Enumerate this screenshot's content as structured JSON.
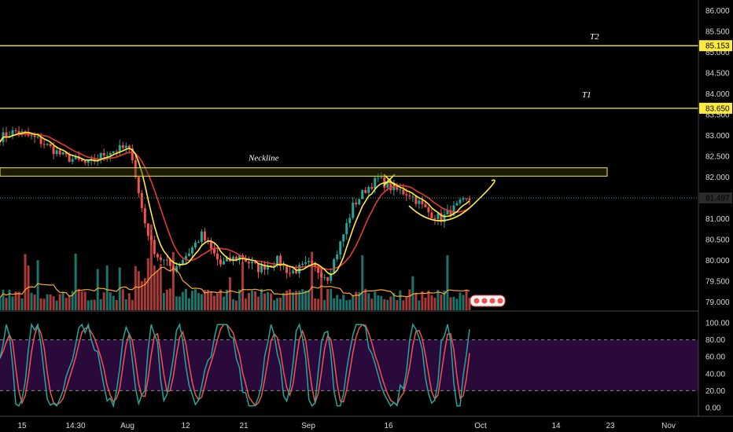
{
  "chart_data": {
    "type": "candlestick",
    "price_axis": {
      "ticks": [
        "79.000",
        "79.500",
        "80.000",
        "80.500",
        "81.000",
        "81.500",
        "82.000",
        "82.500",
        "83.000",
        "83.500",
        "84.000",
        "84.500",
        "85.000",
        "85.500",
        "86.000"
      ],
      "tick_values": [
        79.0,
        79.5,
        80.0,
        80.5,
        81.0,
        81.5,
        82.0,
        82.5,
        83.0,
        83.5,
        84.0,
        84.5,
        85.0,
        85.5,
        86.0
      ],
      "ylim": [
        78.8,
        86.25
      ]
    },
    "oscillator_axis": {
      "ticks": [
        "0.00",
        "20.00",
        "40.00",
        "60.00",
        "80.00",
        "100.00"
      ],
      "tick_values": [
        0,
        20,
        40,
        60,
        80,
        100
      ],
      "overbought": 80,
      "oversold": 20
    },
    "x_ticks": [
      "15",
      "14:30",
      "Aug",
      "12",
      "21",
      "Sep",
      "16",
      "Oct",
      "14",
      "23",
      "Nov"
    ],
    "levels": [
      {
        "name": "T2",
        "value": 85.153,
        "label": "85.153",
        "color": "#ffeb3b"
      },
      {
        "name": "T1",
        "value": 83.65,
        "label": "83.650",
        "color": "#ffeb3b"
      }
    ],
    "last_price": {
      "value": 81.497,
      "label": "81.497"
    },
    "zone": {
      "name": "Neckline",
      "low": 82.02,
      "high": 82.22
    },
    "price_series": {
      "n": 150,
      "close_anchors": [
        [
          0,
          82.95
        ],
        [
          5,
          83.1
        ],
        [
          12,
          82.9
        ],
        [
          20,
          82.5
        ],
        [
          28,
          82.3
        ],
        [
          34,
          82.6
        ],
        [
          40,
          82.7
        ],
        [
          42,
          82.5
        ],
        [
          44,
          81.6
        ],
        [
          46,
          80.9
        ],
        [
          48,
          80.4
        ],
        [
          50,
          80.1
        ],
        [
          55,
          79.8
        ],
        [
          60,
          80.2
        ],
        [
          64,
          80.6
        ],
        [
          70,
          79.9
        ],
        [
          76,
          80.1
        ],
        [
          82,
          79.8
        ],
        [
          88,
          80.0
        ],
        [
          92,
          79.7
        ],
        [
          98,
          79.9
        ],
        [
          104,
          79.6
        ],
        [
          108,
          80.4
        ],
        [
          112,
          81.3
        ],
        [
          116,
          81.7
        ],
        [
          120,
          81.95
        ],
        [
          125,
          81.7
        ],
        [
          130,
          81.6
        ],
        [
          136,
          81.15
        ],
        [
          140,
          81.0
        ],
        [
          146,
          81.35
        ],
        [
          150,
          81.5
        ]
      ],
      "volume_base": 0.6
    },
    "colors": {
      "up": "#26a69a",
      "down": "#ef5350",
      "ma_fast": "#ffeb3b",
      "ma_slow": "#e53935",
      "ma_volume": "#ffa726",
      "stoch_k": "#26a69a",
      "stoch_d": "#ef5350",
      "level": "#ffeb3b",
      "osc_band": "#2a0a3a"
    }
  }
}
